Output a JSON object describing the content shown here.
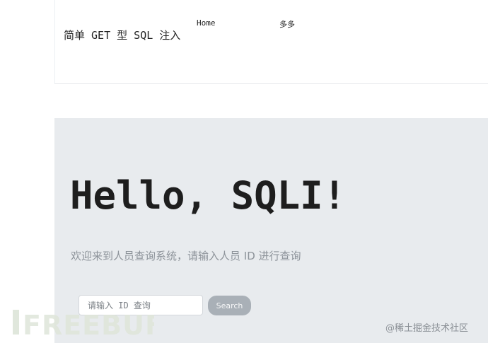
{
  "header": {
    "brand": "简单 GET 型 SQL 注入",
    "nav": [
      {
        "label": "Home"
      },
      {
        "label": "多多"
      }
    ]
  },
  "hero": {
    "title": "Hello, SQLI!",
    "subtitle": "欢迎来到人员查询系统，请输入人员 ID 进行查询"
  },
  "search": {
    "placeholder": "请输入 ID 查询",
    "value": "",
    "button_label": "Search"
  },
  "watermark": {
    "logo_text": "FREEBUF",
    "credit": "@稀土掘金技术社区"
  },
  "colors": {
    "hero_background": "#e8ebee",
    "button_background": "#a9b0b7",
    "subtitle_text": "#8d939a"
  }
}
